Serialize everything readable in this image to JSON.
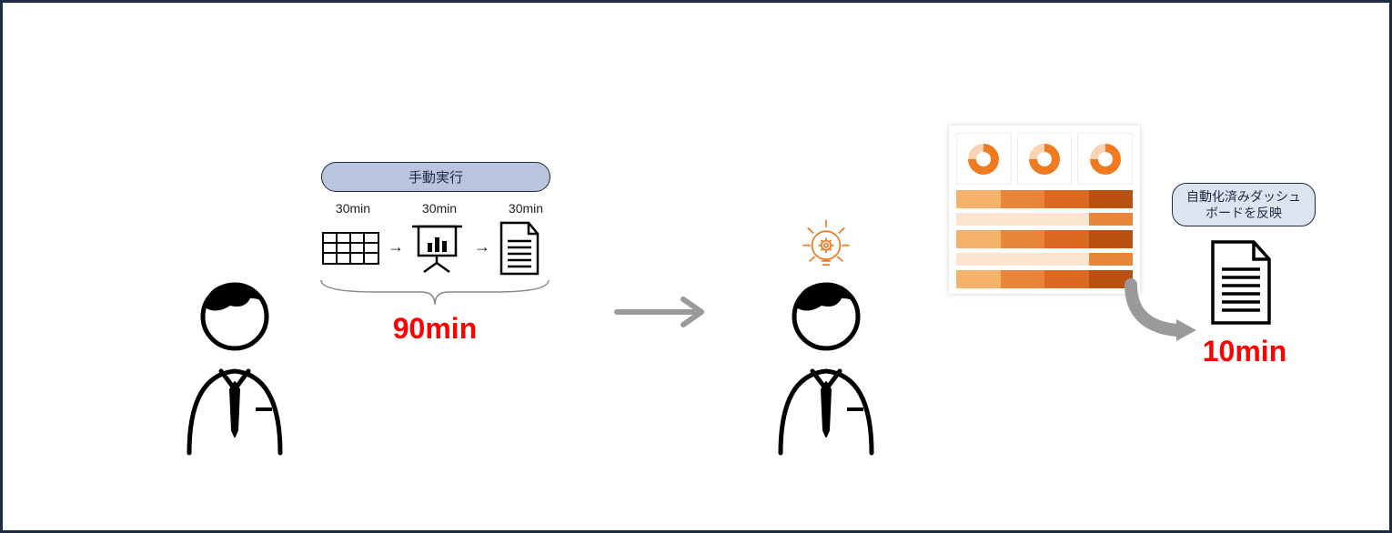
{
  "left": {
    "badge": "手動実行",
    "steps": [
      "30min",
      "30min",
      "30min"
    ],
    "total": "90min"
  },
  "right": {
    "badge_line1": "自動化済みダッシュ",
    "badge_line2": "ボードを反映",
    "total": "10min"
  }
}
